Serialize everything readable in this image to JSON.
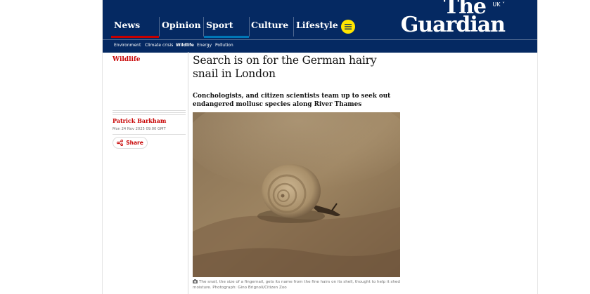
{
  "nav": {
    "pillars": [
      {
        "label": "News",
        "color": "#c70000"
      },
      {
        "label": "Opinion",
        "color": "#e05e00"
      },
      {
        "label": "Sport",
        "color": "#0077b6"
      },
      {
        "label": "Culture",
        "color": "#a1845c"
      },
      {
        "label": "Lifestyle",
        "color": "#bb3b80"
      }
    ],
    "menu_icon": "hamburger-icon",
    "edition": "UK",
    "logo_line1": "The",
    "logo_line2": "Guardian",
    "subnav": [
      "Environment",
      "Climate crisis",
      "Wildlife",
      "Energy",
      "Pollution"
    ],
    "subnav_active": "Wildlife"
  },
  "article": {
    "section": "Wildlife",
    "headline": "Search is on for the German hairy snail in London",
    "standfirst": "Conchologists, and citizen scientists team up to seek out endangered mollusc species along River Thames",
    "byline": "Patrick Barkham",
    "date": "Mon 24 Nov 2025 09.00 GMT",
    "share_label": "Share",
    "caption": "The snail, the size of a fingernail, gets its name from the fine hairs on its shell, thought to help it shed moisture. Photograph: Gino Brignoli/Citizen Zoo"
  },
  "colors": {
    "brand": "#052962",
    "news": "#c70000",
    "menu_button": "#ffe500"
  }
}
